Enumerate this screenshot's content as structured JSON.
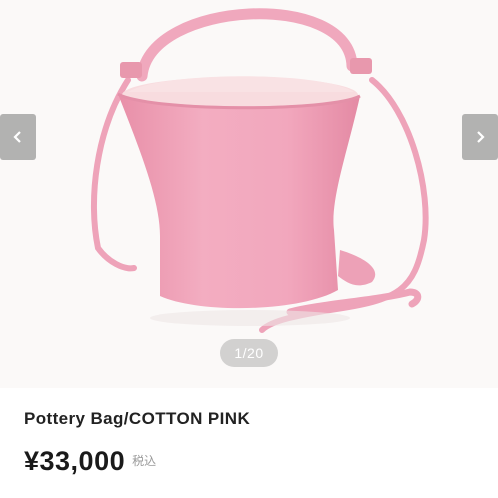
{
  "gallery": {
    "counter": "1/20",
    "prev_icon": "chevron-left-icon",
    "next_icon": "chevron-right-icon"
  },
  "product": {
    "name": "Pottery Bag/COTTON PINK",
    "price": "¥33,000",
    "tax_label": "税込"
  },
  "colors": {
    "bag_pink": "#f2a9be",
    "lining": "#f8dcdf",
    "background": "#fbf9f8",
    "text": "#222222"
  }
}
